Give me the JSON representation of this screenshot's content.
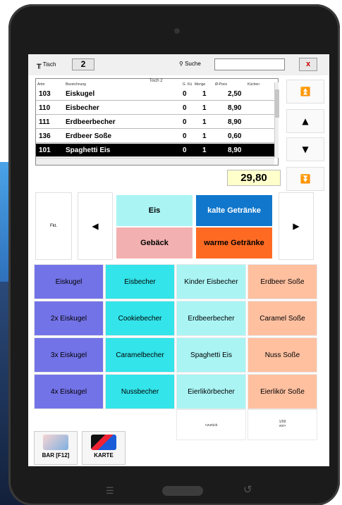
{
  "topbar": {
    "tisch_label": "Tisch",
    "tisch_number": "2",
    "suche_label": "Suche",
    "search_value": "",
    "close_label": "x"
  },
  "grid": {
    "title": "Tisch 2",
    "headers": [
      "Artnr",
      "Bezeichnung",
      "G",
      "Kü",
      "Menge",
      "Ø-Preis",
      "Küchen"
    ],
    "rows": [
      {
        "nr": "103",
        "name": "Eiskugel",
        "g": "0",
        "menge": "1",
        "preis": "2,50"
      },
      {
        "nr": "110",
        "name": "Eisbecher",
        "g": "0",
        "menge": "1",
        "preis": "8,90"
      },
      {
        "nr": "111",
        "name": "Erdbeerbecher",
        "g": "0",
        "menge": "1",
        "preis": "8,90"
      },
      {
        "nr": "136",
        "name": "Erdbeer Soße",
        "g": "0",
        "menge": "1",
        "preis": "0,60"
      },
      {
        "nr": "101",
        "name": "Spaghetti Eis",
        "g": "0",
        "menge": "1",
        "preis": "8,90"
      }
    ]
  },
  "total": "29,80",
  "nav": {
    "top_icon": "double-up-arrow-icon",
    "up_icon": "up-arrow-icon",
    "down_icon": "down-arrow-icon",
    "bottom_icon": "double-down-arrow-icon"
  },
  "categories": {
    "fkt_label": "Fkt.",
    "eis": "Eis",
    "kalte": "kalte Getränke",
    "geback": "Gebäck",
    "warme": "warme Getränke"
  },
  "products": [
    [
      "Eiskugel",
      "Eisbecher",
      "Kinder Eisbecher",
      "Erdbeer Soße"
    ],
    [
      "2x Eiskugel",
      "Cookiebecher",
      "Erdbeerbecher",
      "Caramel Soße"
    ],
    [
      "3x Eiskugel",
      "Caramelbecher",
      "Spaghetti Eis",
      "Nuss Soße"
    ],
    [
      "4x Eiskugel",
      "Nussbecher",
      "Eierlikörbecher",
      "Eierlikör Soße"
    ]
  ],
  "pager": {
    "back": "<zurück",
    "page": "1/99",
    "next": "vor>"
  },
  "payment": {
    "bar": "BAR [F12]",
    "karte": "KARTE"
  },
  "colors": {
    "category_eis": "#aaf4f4",
    "category_kalte": "#1177cc",
    "category_geback": "#f3b0b0",
    "category_warme": "#ff6a22",
    "product_col1": "#7373e8",
    "product_col2": "#33e4ea",
    "product_col3": "#aaf4f4",
    "product_col4": "#ffc0a0",
    "total_bg": "#ffffcc"
  }
}
